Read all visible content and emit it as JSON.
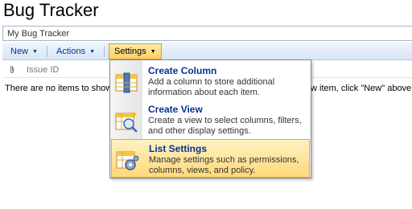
{
  "page": {
    "title": "Bug Tracker"
  },
  "breadcrumb": {
    "text": "My Bug Tracker"
  },
  "toolbar": {
    "new_label": "New",
    "actions_label": "Actions",
    "settings_label": "Settings"
  },
  "list": {
    "column_header": "Issue ID",
    "empty_message_left": "There are no items to show",
    "empty_message_right": "w item, click \"New\" above."
  },
  "settings_menu": {
    "items": [
      {
        "title": "Create Column",
        "description": "Add a column to store additional information about each item.",
        "icon": "create-column-icon"
      },
      {
        "title": "Create View",
        "description": "Create a view to select columns, filters, and other display settings.",
        "icon": "create-view-icon"
      },
      {
        "title": "List Settings",
        "description": "Manage settings such as permissions, columns, views, and policy.",
        "icon": "list-settings-icon",
        "highlighted": true
      }
    ]
  },
  "colors": {
    "link_blue": "#003399",
    "toolbar_gradient_top": "#f0f5fc",
    "toolbar_gradient_bottom": "#d8e6f5",
    "highlight_top": "#fff1c2",
    "highlight_bottom": "#ffd97a"
  }
}
